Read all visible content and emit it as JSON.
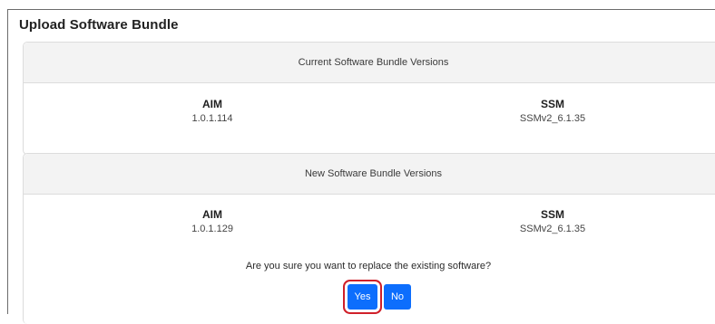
{
  "dialog": {
    "title": "Upload Software Bundle"
  },
  "current": {
    "header": "Current Software Bundle Versions",
    "aim_label": "AIM",
    "aim_value": "1.0.1.114",
    "ssm_label": "SSM",
    "ssm_value": "SSMv2_6.1.35"
  },
  "new": {
    "header": "New Software Bundle Versions",
    "aim_label": "AIM",
    "aim_value": "1.0.1.129",
    "ssm_label": "SSM",
    "ssm_value": "SSMv2_6.1.35",
    "question": "Are you sure you want to replace the existing software?",
    "yes_label": "Yes",
    "no_label": "No"
  },
  "colors": {
    "primary_button": "#0d6efd",
    "highlight_ring": "#d0202a",
    "card_header_bg": "#f3f3f3"
  }
}
